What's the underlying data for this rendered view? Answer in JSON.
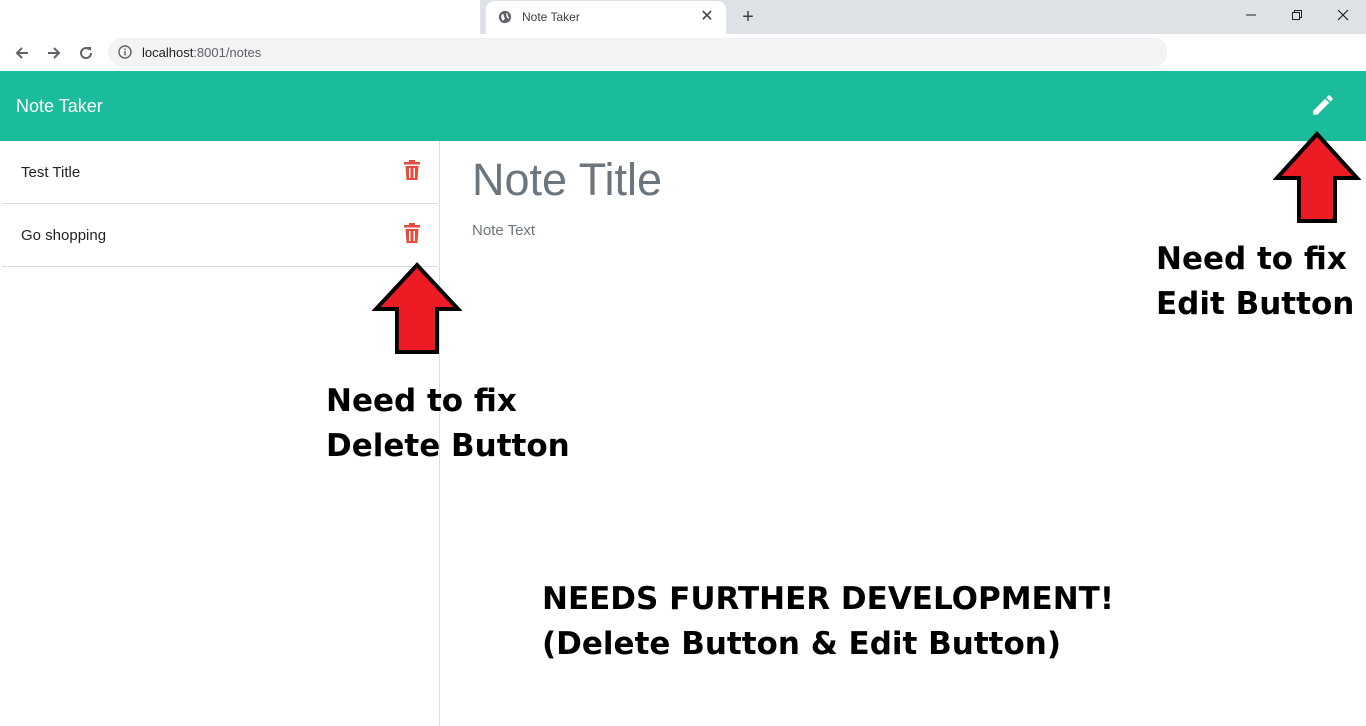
{
  "browser": {
    "tab_title": "Note Taker",
    "url_host": "localhost",
    "url_rest": ":8001/notes"
  },
  "app": {
    "brand": "Note Taker",
    "accent_color": "#1abc9c",
    "delete_color": "#e74c3c",
    "edit_icon": "pencil-icon"
  },
  "notes": [
    {
      "title": "Test Title"
    },
    {
      "title": "Go shopping"
    }
  ],
  "editor": {
    "title_placeholder": "Note Title",
    "text_placeholder": "Note Text"
  },
  "annotations": {
    "edit_line1": "Need to fix",
    "edit_line2": "Edit Button",
    "delete_line1": "Need to fix",
    "delete_line2": "Delete Button",
    "dev_line1": "NEEDS FURTHER DEVELOPMENT!",
    "dev_line2": "(Delete Button & Edit Button)"
  }
}
